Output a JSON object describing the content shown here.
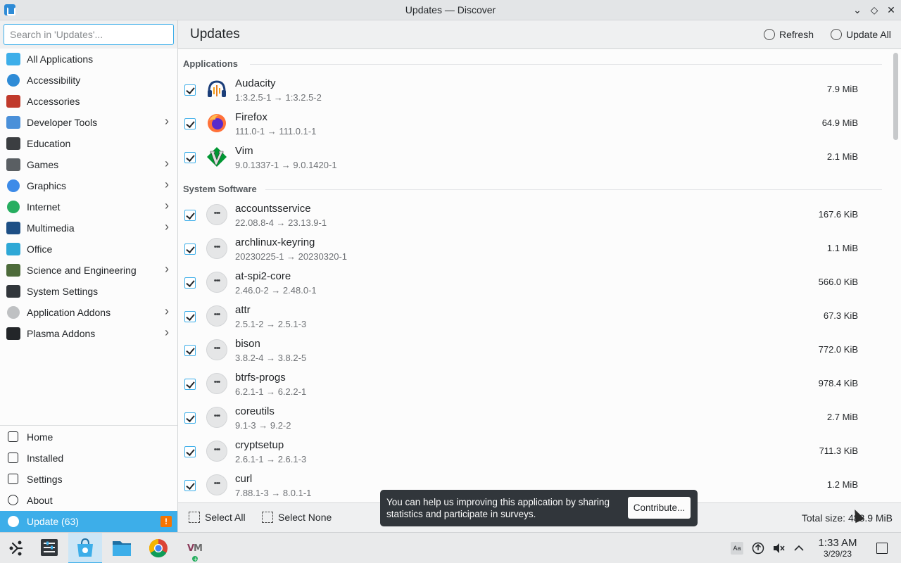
{
  "window": {
    "title": "Updates — Discover"
  },
  "search": {
    "placeholder": "Search in 'Updates'..."
  },
  "header": {
    "title": "Updates",
    "refresh_label": "Refresh",
    "update_all_label": "Update All"
  },
  "sidebar": {
    "categories": [
      {
        "label": "All Applications",
        "icon": "grid-icon",
        "color": "#3daee9",
        "submenu": false
      },
      {
        "label": "Accessibility",
        "icon": "accessibility-icon",
        "color": "#2e8bd6",
        "submenu": false
      },
      {
        "label": "Accessories",
        "icon": "toolbox-icon",
        "color": "#c0392b",
        "submenu": false
      },
      {
        "label": "Developer Tools",
        "icon": "developer-tools-icon",
        "color": "#4a90d9",
        "submenu": true
      },
      {
        "label": "Education",
        "icon": "chalkboard-icon",
        "color": "#3b3e41",
        "submenu": false
      },
      {
        "label": "Games",
        "icon": "gamepad-icon",
        "color": "#5a5f63",
        "submenu": true
      },
      {
        "label": "Graphics",
        "icon": "graphics-icon",
        "color": "#3d8be8",
        "submenu": true
      },
      {
        "label": "Internet",
        "icon": "globe-icon",
        "color": "#27ae60",
        "submenu": true
      },
      {
        "label": "Multimedia",
        "icon": "monitor-icon",
        "color": "#1d4f85",
        "submenu": true
      },
      {
        "label": "Office",
        "icon": "office-icon",
        "color": "#2ea8d6",
        "submenu": false
      },
      {
        "label": "Science and Engineering",
        "icon": "flask-icon",
        "color": "#4d6b3a",
        "submenu": true
      },
      {
        "label": "System Settings",
        "icon": "settings-panel-icon",
        "color": "#31363b",
        "submenu": false
      },
      {
        "label": "Application Addons",
        "icon": "dots-icon",
        "color": "#bfc1c3",
        "submenu": true
      },
      {
        "label": "Plasma Addons",
        "icon": "plasma-icon",
        "color": "#232629",
        "submenu": true
      }
    ],
    "nav": [
      {
        "label": "Home",
        "icon": "home-icon"
      },
      {
        "label": "Installed",
        "icon": "installed-icon"
      },
      {
        "label": "Settings",
        "icon": "settings-icon"
      },
      {
        "label": "About",
        "icon": "info-icon"
      }
    ],
    "update": {
      "label": "Update (63)",
      "icon": "update-icon"
    }
  },
  "sections": {
    "applications": "Applications",
    "system": "System Software"
  },
  "apps": [
    {
      "name": "Audacity",
      "version": "1:3.2.5-1 → 1:3.2.5-2",
      "size": "7.9 MiB",
      "icon": "audacity-icon"
    },
    {
      "name": "Firefox",
      "version": "111.0-1 → 111.0.1-1",
      "size": "64.9 MiB",
      "icon": "firefox-icon"
    },
    {
      "name": "Vim",
      "version": "9.0.1337-1 → 9.0.1420-1",
      "size": "2.1 MiB",
      "icon": "vim-icon"
    }
  ],
  "system": [
    {
      "name": "accountsservice",
      "version": "22.08.8-4 → 23.13.9-1",
      "size": "167.6 KiB"
    },
    {
      "name": "archlinux-keyring",
      "version": "20230225-1 → 20230320-1",
      "size": "1.1 MiB"
    },
    {
      "name": "at-spi2-core",
      "version": "2.46.0-2 → 2.48.0-1",
      "size": "566.0 KiB"
    },
    {
      "name": "attr",
      "version": "2.5.1-2 → 2.5.1-3",
      "size": "67.3 KiB"
    },
    {
      "name": "bison",
      "version": "3.8.2-4 → 3.8.2-5",
      "size": "772.0 KiB"
    },
    {
      "name": "btrfs-progs",
      "version": "6.2.1-1 → 6.2.2-1",
      "size": "978.4 KiB"
    },
    {
      "name": "coreutils",
      "version": "9.1-3 → 9.2-2",
      "size": "2.7 MiB"
    },
    {
      "name": "cryptsetup",
      "version": "2.6.1-1 → 2.6.1-3",
      "size": "711.3 KiB"
    },
    {
      "name": "curl",
      "version": "7.88.1-3 → 8.0.1-1",
      "size": "1.2 MiB"
    }
  ],
  "footer": {
    "select_all": "Select All",
    "select_none": "Select None",
    "total": "Total size: 488.9 MiB"
  },
  "toast": {
    "text": "You can help us improving this application by sharing statistics and participate in surveys.",
    "button": "Contribute..."
  },
  "taskbar": {
    "apps": [
      "app-launcher-icon",
      "system-settings-icon",
      "discover-icon",
      "file-manager-icon",
      "chrome-icon",
      "vim-app-icon"
    ],
    "tray": [
      "keyboard-layout-icon",
      "updates-tray-icon",
      "volume-muted-icon",
      "expand-tray-icon"
    ],
    "time": "1:33 AM",
    "date": "3/29/23"
  },
  "colors": {
    "accent": "#3daee9",
    "warning": "#f67400"
  }
}
